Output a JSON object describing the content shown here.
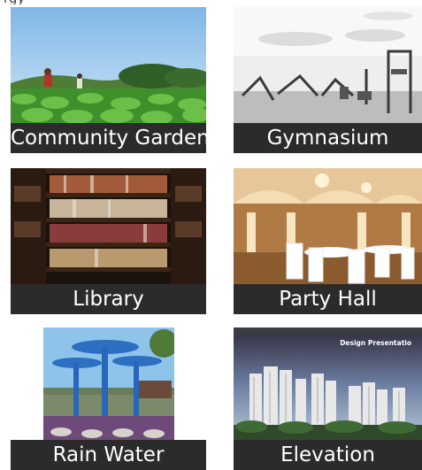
{
  "header_fragment": "rgy",
  "amenities": [
    {
      "name": "Community Garden"
    },
    {
      "name": "Gymnasium"
    },
    {
      "name": "Library"
    },
    {
      "name": "Party Hall"
    },
    {
      "name": "Rain Water"
    },
    {
      "name": "Elevation",
      "banner": "Design Presentatio"
    }
  ]
}
